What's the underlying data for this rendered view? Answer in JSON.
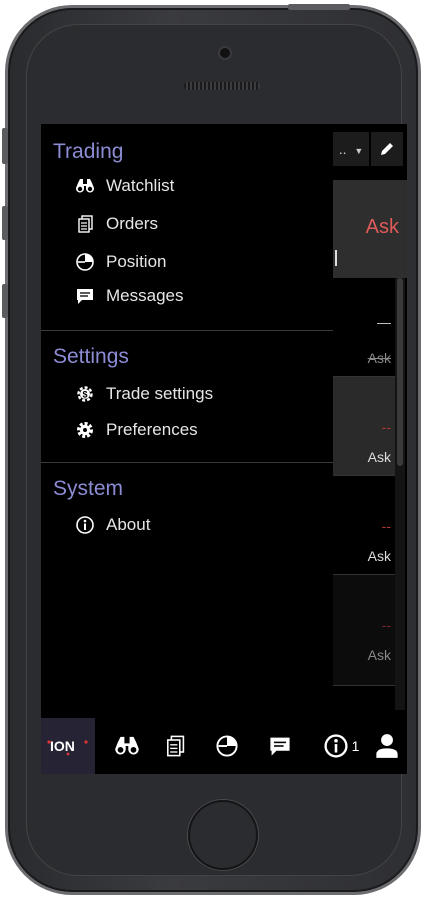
{
  "background_app": {
    "dropdown_label": "..",
    "header_ask": "Ask",
    "rows": [
      {
        "dash": "—",
        "ask": "Ask"
      },
      {
        "dash": "--",
        "ask": "Ask"
      },
      {
        "dash": "--",
        "ask": "Ask"
      },
      {
        "dash": "--",
        "ask": "Ask"
      }
    ]
  },
  "menu": {
    "sections": [
      {
        "header": "Trading",
        "items": [
          {
            "label": "Watchlist",
            "icon": "binoculars-icon"
          },
          {
            "label": "Orders",
            "icon": "orders-icon"
          },
          {
            "label": "Position",
            "icon": "pie-chart-icon"
          },
          {
            "label": "Messages",
            "icon": "message-icon"
          }
        ]
      },
      {
        "header": "Settings",
        "items": [
          {
            "label": "Trade settings",
            "icon": "dollar-gear-icon"
          },
          {
            "label": "Preferences",
            "icon": "gear-icon"
          }
        ]
      },
      {
        "header": "System",
        "items": [
          {
            "label": "About",
            "icon": "info-icon"
          }
        ]
      }
    ]
  },
  "tabbar": {
    "logo": "ION",
    "info_count": "1",
    "colors": {
      "logo_bg": "#262434",
      "logo_red": "#e0323c"
    }
  },
  "colors": {
    "menu_header": "#8c8cd4",
    "menu_text": "#e6e6e6",
    "ask_red": "#e05a5a"
  }
}
